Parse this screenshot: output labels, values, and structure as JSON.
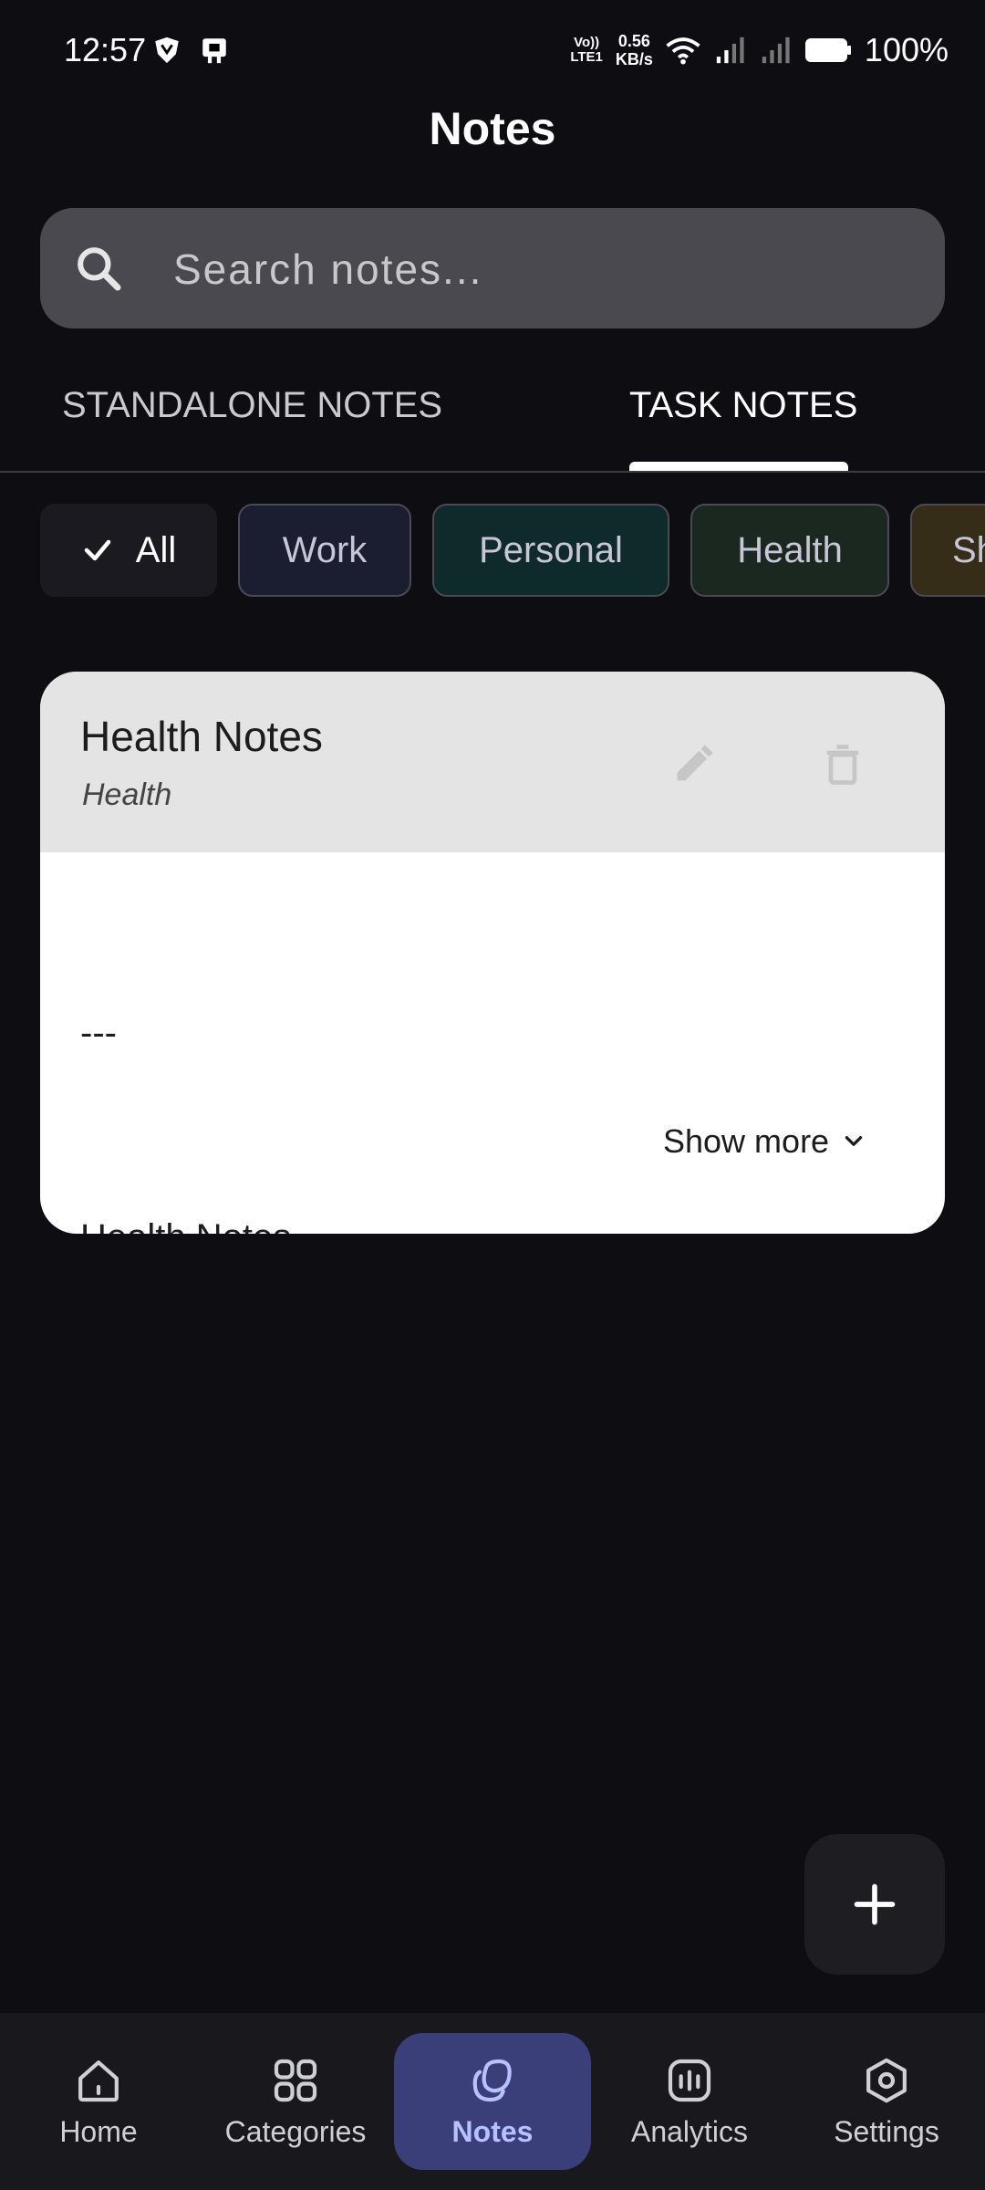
{
  "status_bar": {
    "time": "12:57",
    "volte_line1": "Vo))",
    "volte_line2": "LTE1",
    "net_speed_value": "0.56",
    "net_speed_unit": "KB/s",
    "battery": "100%"
  },
  "page": {
    "title": "Notes"
  },
  "search": {
    "placeholder": "Search notes..."
  },
  "tabs": [
    {
      "label": "STANDALONE NOTES",
      "active": false
    },
    {
      "label": "TASK NOTES",
      "active": true
    }
  ],
  "filter_chips": [
    {
      "label": "All",
      "selected": true,
      "color": "#1a1a20"
    },
    {
      "label": "Work",
      "selected": false,
      "color": "#1b1d30"
    },
    {
      "label": "Personal",
      "selected": false,
      "color": "#0f2a2b"
    },
    {
      "label": "Health",
      "selected": false,
      "color": "#1a281f"
    },
    {
      "label": "Sh",
      "selected": false,
      "color": "#352d18"
    }
  ],
  "note": {
    "title": "Health Notes",
    "category": "Health",
    "body_line1": "---",
    "body_line2": "Health Notes",
    "show_more": "Show more"
  },
  "fab": {
    "icon": "plus-icon"
  },
  "bottom_nav": [
    {
      "label": "Home",
      "icon": "home-icon",
      "active": false
    },
    {
      "label": "Categories",
      "icon": "grid-icon",
      "active": false
    },
    {
      "label": "Notes",
      "icon": "notes-icon",
      "active": true
    },
    {
      "label": "Analytics",
      "icon": "analytics-icon",
      "active": false
    },
    {
      "label": "Settings",
      "icon": "settings-icon",
      "active": false
    }
  ],
  "colors": {
    "background": "#0e0e12",
    "search_bg": "#49494f",
    "card_header": "#e4e4e4",
    "nav_active_bg": "#3a3f7a",
    "nav_active_text": "#b8c0ff"
  }
}
